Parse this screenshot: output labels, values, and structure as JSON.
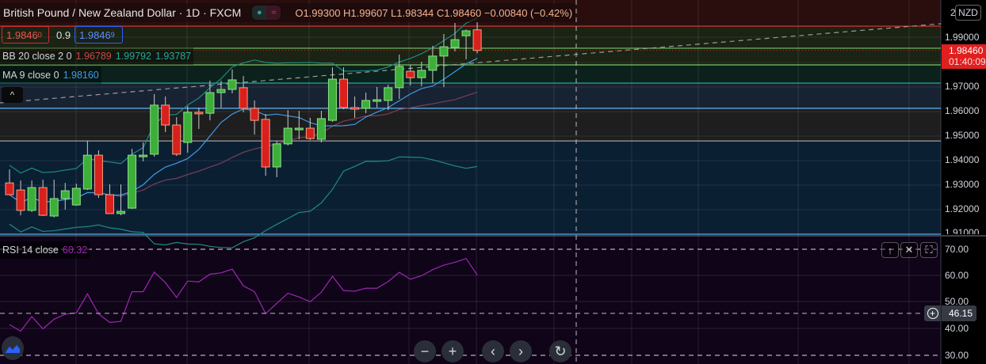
{
  "header": {
    "symbol": "British Pound / New Zealand Dollar · 1D · FXCM",
    "toggle_dot": "●",
    "toggle_wave": "≈",
    "ohlc": "O1.99300  H1.99607  L1.98344  C1.98460  −0.00840 (−0.42%)"
  },
  "quote": {
    "sell": "1.9846",
    "sell_sup": "0",
    "spread": "0.9",
    "buy": "1.9846",
    "buy_sup": "9"
  },
  "legend": {
    "bb_label": "BB 20 close 2 0",
    "bb_basis": "1.96789",
    "bb_upper": "1.99792",
    "bb_lower": "1.93787",
    "ma_label": "MA 9 close 0",
    "ma_value": "1.98160",
    "rsi_label": "RSI 14 close",
    "rsi_value": "60.32",
    "collapse": "^"
  },
  "price_axis": {
    "currency": "NZD",
    "top_partial": "2",
    "labels": [
      "1.99000",
      "1.97000",
      "1.96000",
      "1.95000",
      "1.94000",
      "1.93000",
      "1.92000",
      "1.91000"
    ],
    "current_price": "1.98460",
    "countdown": "01:40:09"
  },
  "rsi_axis": {
    "labels": [
      "70.00",
      "60.00",
      "50.00",
      "40.00",
      "30.00"
    ],
    "crosshair_value": "46.15"
  },
  "pane_buttons": {
    "up": "↑",
    "close": "✕",
    "maximize": "⛶"
  },
  "nav": {
    "zoom_out": "−",
    "zoom_in": "+",
    "back": "‹",
    "forward": "›",
    "reset": "↻"
  },
  "colors": {
    "up": "#3dae3a",
    "down": "#d8201c",
    "ma": "#3f9be8",
    "bb_basis": "#7b3f57",
    "bb_band": "#1e8c84",
    "rsi": "#9c27b0"
  },
  "chart_data": {
    "type": "candlestick",
    "timeframe": "1D",
    "ohlc": [
      [
        1.9306,
        1.9361,
        1.9258,
        1.9258
      ],
      [
        1.9277,
        1.9316,
        1.9174,
        1.9194
      ],
      [
        1.9194,
        1.9316,
        1.9187,
        1.9287
      ],
      [
        1.9287,
        1.9319,
        1.9171,
        1.9174
      ],
      [
        1.9171,
        1.9319,
        1.9165,
        1.9242
      ],
      [
        1.9242,
        1.9306,
        1.9197,
        1.9274
      ],
      [
        1.9216,
        1.9303,
        1.9213,
        1.9284
      ],
      [
        1.9281,
        1.9477,
        1.9277,
        1.9419
      ],
      [
        1.9419,
        1.9439,
        1.9245,
        1.9258
      ],
      [
        1.9258,
        1.93,
        1.9181,
        1.9181
      ],
      [
        1.9181,
        1.93,
        1.9174,
        1.919
      ],
      [
        1.9203,
        1.9445,
        1.92,
        1.9419
      ],
      [
        1.9416,
        1.9471,
        1.9394,
        1.9419
      ],
      [
        1.9423,
        1.9668,
        1.9413,
        1.9623
      ],
      [
        1.9623,
        1.9658,
        1.9513,
        1.9542
      ],
      [
        1.9542,
        1.9574,
        1.9416,
        1.9423
      ],
      [
        1.9471,
        1.9619,
        1.9429,
        1.9594
      ],
      [
        1.9594,
        1.9613,
        1.9526,
        1.959
      ],
      [
        1.959,
        1.9723,
        1.9561,
        1.9674
      ],
      [
        1.9674,
        1.9723,
        1.9613,
        1.9687
      ],
      [
        1.9687,
        1.9768,
        1.9671,
        1.9726
      ],
      [
        1.9694,
        1.9742,
        1.9594,
        1.961
      ],
      [
        1.961,
        1.9642,
        1.9503,
        1.9561
      ],
      [
        1.9565,
        1.9587,
        1.9335,
        1.9371
      ],
      [
        1.9371,
        1.9477,
        1.9329,
        1.9465
      ],
      [
        1.9465,
        1.9603,
        1.9458,
        1.9529
      ],
      [
        1.9526,
        1.96,
        1.9484,
        1.9529
      ],
      [
        1.9529,
        1.9571,
        1.9481,
        1.9487
      ],
      [
        1.9484,
        1.96,
        1.9471,
        1.9568
      ],
      [
        1.9561,
        1.9777,
        1.9555,
        1.9729
      ],
      [
        1.9729,
        1.9777,
        1.9606,
        1.9613
      ],
      [
        1.9613,
        1.9658,
        1.9571,
        1.961
      ],
      [
        1.961,
        1.9674,
        1.959,
        1.9642
      ],
      [
        1.9642,
        1.9697,
        1.9613,
        1.9645
      ],
      [
        1.9642,
        1.9706,
        1.9603,
        1.9694
      ],
      [
        1.9694,
        1.9829,
        1.9648,
        1.9781
      ],
      [
        1.9761,
        1.9787,
        1.9703,
        1.9735
      ],
      [
        1.9735,
        1.98,
        1.97,
        1.9765
      ],
      [
        1.9765,
        1.9865,
        1.9713,
        1.9823
      ],
      [
        1.9823,
        1.9913,
        1.9697,
        1.9861
      ],
      [
        1.9858,
        1.9958,
        1.9842,
        1.989
      ],
      [
        1.9906,
        1.9932,
        1.981,
        1.9926
      ],
      [
        1.993,
        1.99607,
        1.98344,
        1.9846
      ]
    ],
    "rsi": [
      41.6,
      39.1,
      44.6,
      40.0,
      43.6,
      45.5,
      46.0,
      53.2,
      45.6,
      42.4,
      42.8,
      54.0,
      54.0,
      61.4,
      57.4,
      51.8,
      58.0,
      57.7,
      60.6,
      61.1,
      62.5,
      56.2,
      54.0,
      45.7,
      49.6,
      53.4,
      52.0,
      50.2,
      53.8,
      59.8,
      54.4,
      54.2,
      55.3,
      55.3,
      57.8,
      61.3,
      58.7,
      60.0,
      62.3,
      64.0,
      65.1,
      66.5,
      60.32
    ],
    "price_range": [
      1.908,
      2.0005
    ],
    "rsi_range": [
      27,
      75
    ],
    "levels": [
      {
        "price": 1.9945,
        "color": "#e53935"
      },
      {
        "price": 1.9855,
        "color": "#7cc46b"
      },
      {
        "price": 1.9787,
        "color": "#7cc46b"
      },
      {
        "price": 1.9713,
        "color": "#26a69a"
      },
      {
        "price": 1.961,
        "color": "#64b5f6"
      },
      {
        "price": 1.9477,
        "color": "#9e9e9e"
      },
      {
        "price": 1.9097,
        "color": "#64b5f6"
      }
    ],
    "rsi_bands": [
      70,
      30
    ]
  }
}
